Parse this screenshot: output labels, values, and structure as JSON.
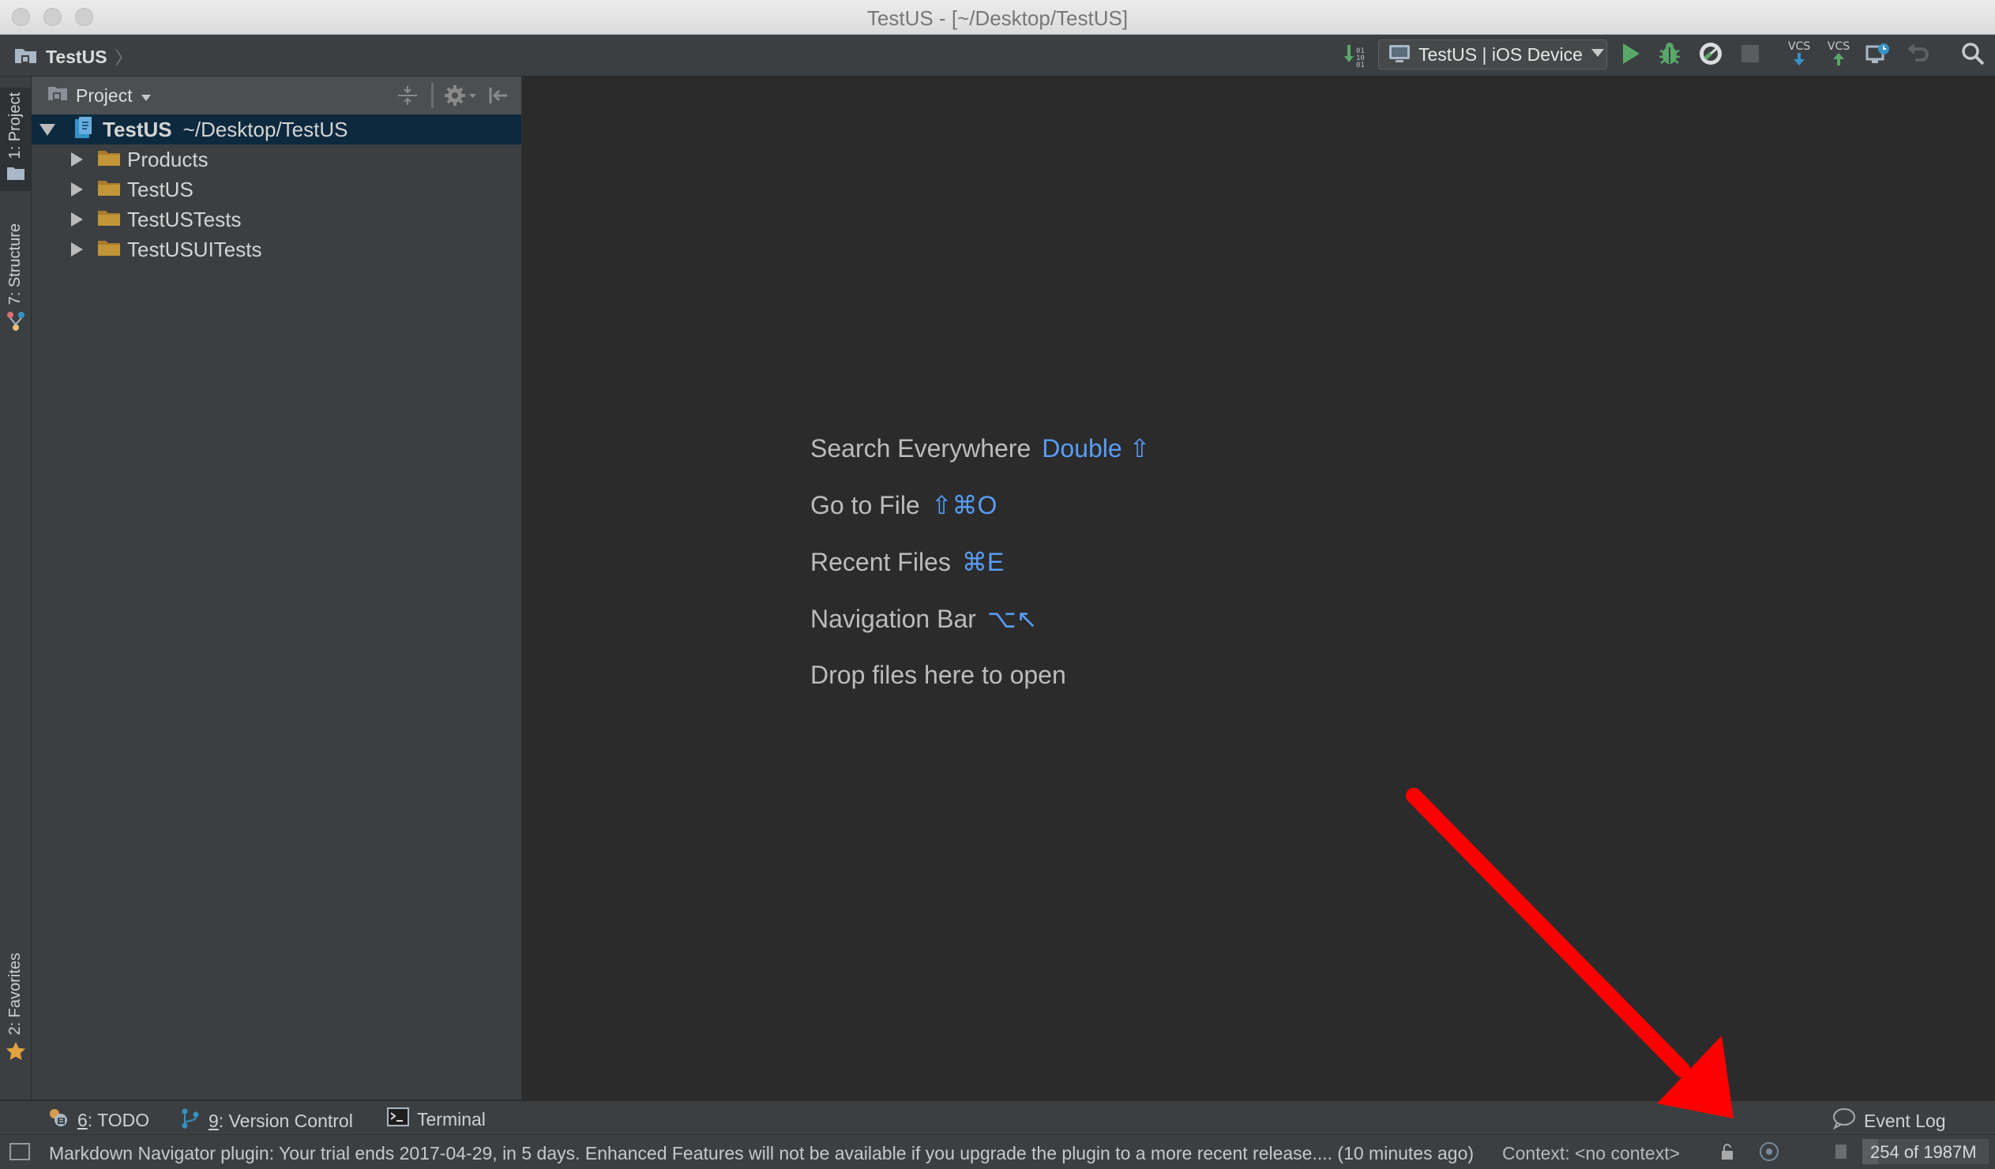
{
  "window": {
    "title": "TestUS - [~/Desktop/TestUS]"
  },
  "navbar": {
    "breadcrumb": "TestUS",
    "run_config": "TestUS | iOS Device",
    "icons": [
      "vcs-update-project-icon",
      "run-config-dropdown-icon",
      "run-icon",
      "debug-icon",
      "profile-icon",
      "stop-icon",
      "vcs-update-icon",
      "vcs-commit-icon",
      "vcs-history-icon",
      "revert-icon",
      "search-icon"
    ],
    "vcs_label": "VCS",
    "accent_run": "#59a869",
    "accent_vcs_update": "#3592c4",
    "accent_vcs_commit": "#59a869"
  },
  "left_stripe": {
    "project_tab": "1: Project",
    "structure_tab": "7: Structure",
    "favorites_tab": "2: Favorites"
  },
  "project_panel": {
    "header_label": "Project",
    "tree": [
      {
        "name": "TestUS",
        "path": "~/Desktop/TestUS",
        "expanded": true,
        "selected": true
      },
      {
        "name": "Products",
        "expanded": false
      },
      {
        "name": "TestUS",
        "expanded": false
      },
      {
        "name": "TestUSTests",
        "expanded": false
      },
      {
        "name": "TestUSUITests",
        "expanded": false
      }
    ]
  },
  "editor": {
    "hints": [
      {
        "label": "Search Everywhere",
        "shortcut": "Double ⇧"
      },
      {
        "label": "Go to File",
        "shortcut": "⇧⌘O"
      },
      {
        "label": "Recent Files",
        "shortcut": "⌘E"
      },
      {
        "label": "Navigation Bar",
        "shortcut": "⌥↖"
      },
      {
        "label": "Drop files here to open",
        "shortcut": ""
      }
    ],
    "shortcut_color": "#589df6"
  },
  "bottom_bar": {
    "todo_num": "6",
    "todo_label": ": TODO",
    "vcs_num": "9",
    "vcs_label": ": Version Control",
    "terminal_label": "Terminal",
    "event_log_label": "Event Log"
  },
  "status_bar": {
    "message": "Markdown Navigator plugin: Your trial ends 2017-04-29, in 5 days. Enhanced Features will not be available if you upgrade the plugin to a more recent release.... (10 minutes ago)",
    "context": "Context: <no context>",
    "memory": "254 of 1987M",
    "memory_used_fraction": 0.128
  },
  "annotation": {
    "arrow_color": "#ff0000"
  }
}
